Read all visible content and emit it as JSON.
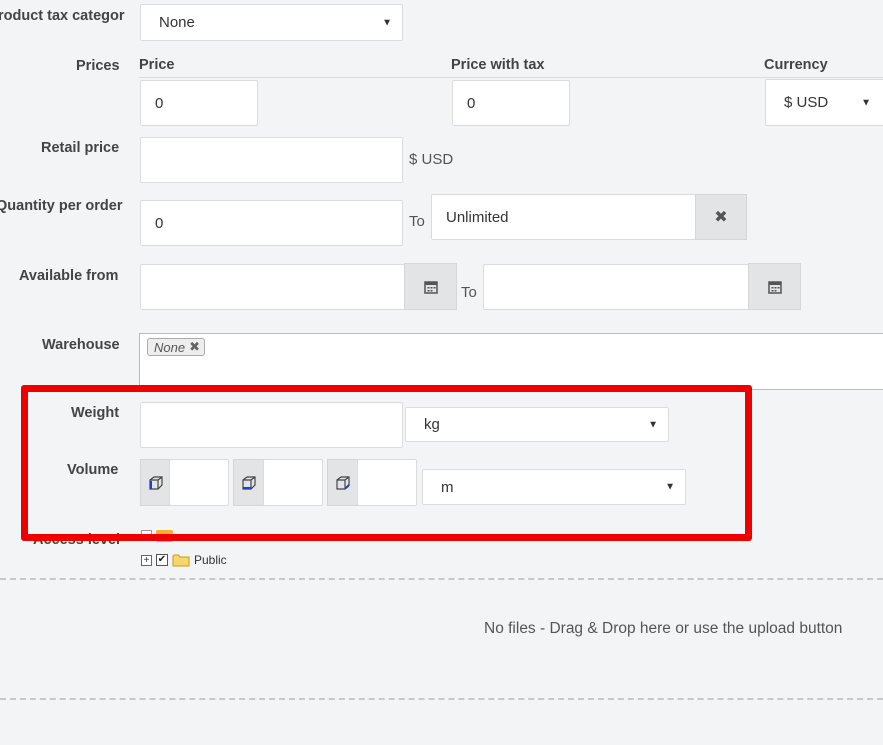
{
  "product_tax": {
    "label": "roduct tax categor",
    "value": "None"
  },
  "prices": {
    "label": "Prices",
    "col_price": "Price",
    "col_price_with_tax": "Price with tax",
    "col_currency": "Currency",
    "price_value": "0",
    "price_with_tax_value": "0",
    "currency_value": "$ USD"
  },
  "retail": {
    "label": "Retail price",
    "value": "",
    "currency": "$ USD"
  },
  "quantity": {
    "label": "Quantity per order",
    "from_value": "0",
    "to_label": "To",
    "to_value": "Unlimited"
  },
  "available": {
    "label": "Available from",
    "from_value": "",
    "to_label": "To",
    "to_value": ""
  },
  "warehouse": {
    "label": "Warehouse",
    "tag": "None"
  },
  "weight": {
    "label": "Weight",
    "value": "",
    "unit": "kg"
  },
  "volume": {
    "label": "Volume",
    "length": "",
    "width": "",
    "height": "",
    "unit": "m"
  },
  "access": {
    "label": "Access level",
    "tree_item": "Public"
  },
  "uploads": {
    "empty_text": "No files - Drag & Drop here or use the upload button"
  },
  "colors": {
    "highlight": "#ee0000",
    "addon_bg": "#e3e4e6",
    "page_bg": "#f3f4f6"
  },
  "icons": {
    "caret": "caret-down-icon",
    "clear": "close-icon",
    "calendar": "calendar-icon",
    "box": "box-icon",
    "folder": "folder-icon"
  }
}
